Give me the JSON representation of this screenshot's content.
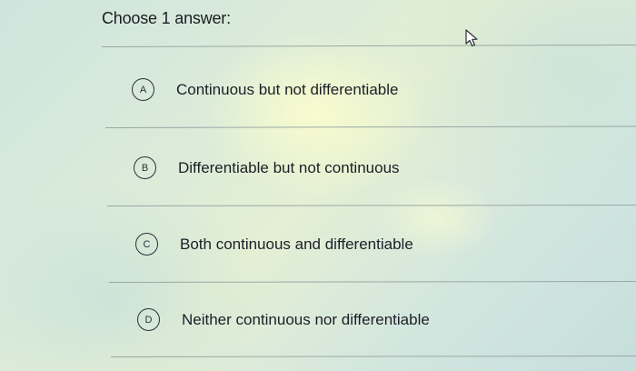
{
  "question": {
    "prompt": "Choose 1 answer:"
  },
  "options": [
    {
      "letter": "A",
      "label": "Continuous but not differentiable"
    },
    {
      "letter": "B",
      "label": "Differentiable but not continuous"
    },
    {
      "letter": "C",
      "label": "Both continuous and differentiable"
    },
    {
      "letter": "D",
      "label": "Neither continuous nor differentiable"
    }
  ],
  "cursor": {
    "icon": "arrow-pointer-icon"
  }
}
